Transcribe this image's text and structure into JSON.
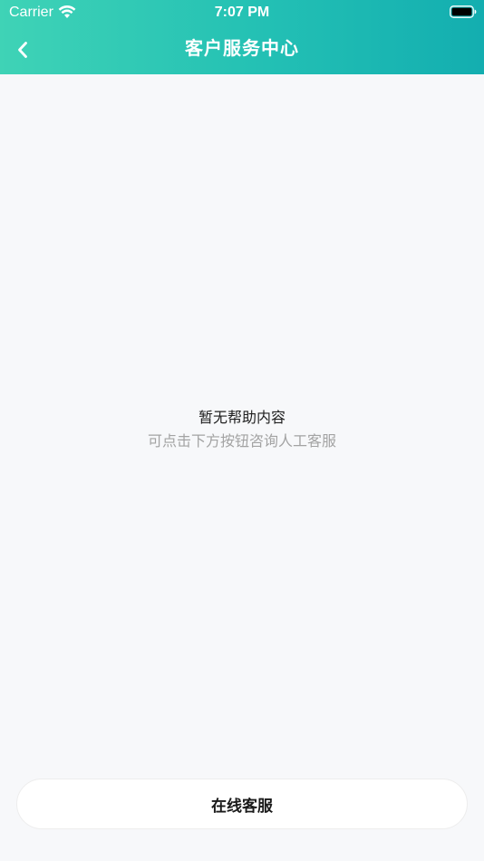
{
  "status_bar": {
    "carrier": "Carrier",
    "time": "7:07 PM",
    "wifi_icon": "wifi-icon",
    "battery_icon": "battery-icon"
  },
  "nav": {
    "back_icon": "chevron-left-icon",
    "title": "客户服务中心"
  },
  "empty_state": {
    "title": "暂无帮助内容",
    "subtitle": "可点击下方按钮咨询人工客服"
  },
  "actions": {
    "online_service_label": "在线客服"
  },
  "colors": {
    "header_gradient_start": "#3fd3b6",
    "header_gradient_end": "#13aeb0",
    "background": "#f7f8fa",
    "subtitle_text": "#a3a3a3"
  }
}
